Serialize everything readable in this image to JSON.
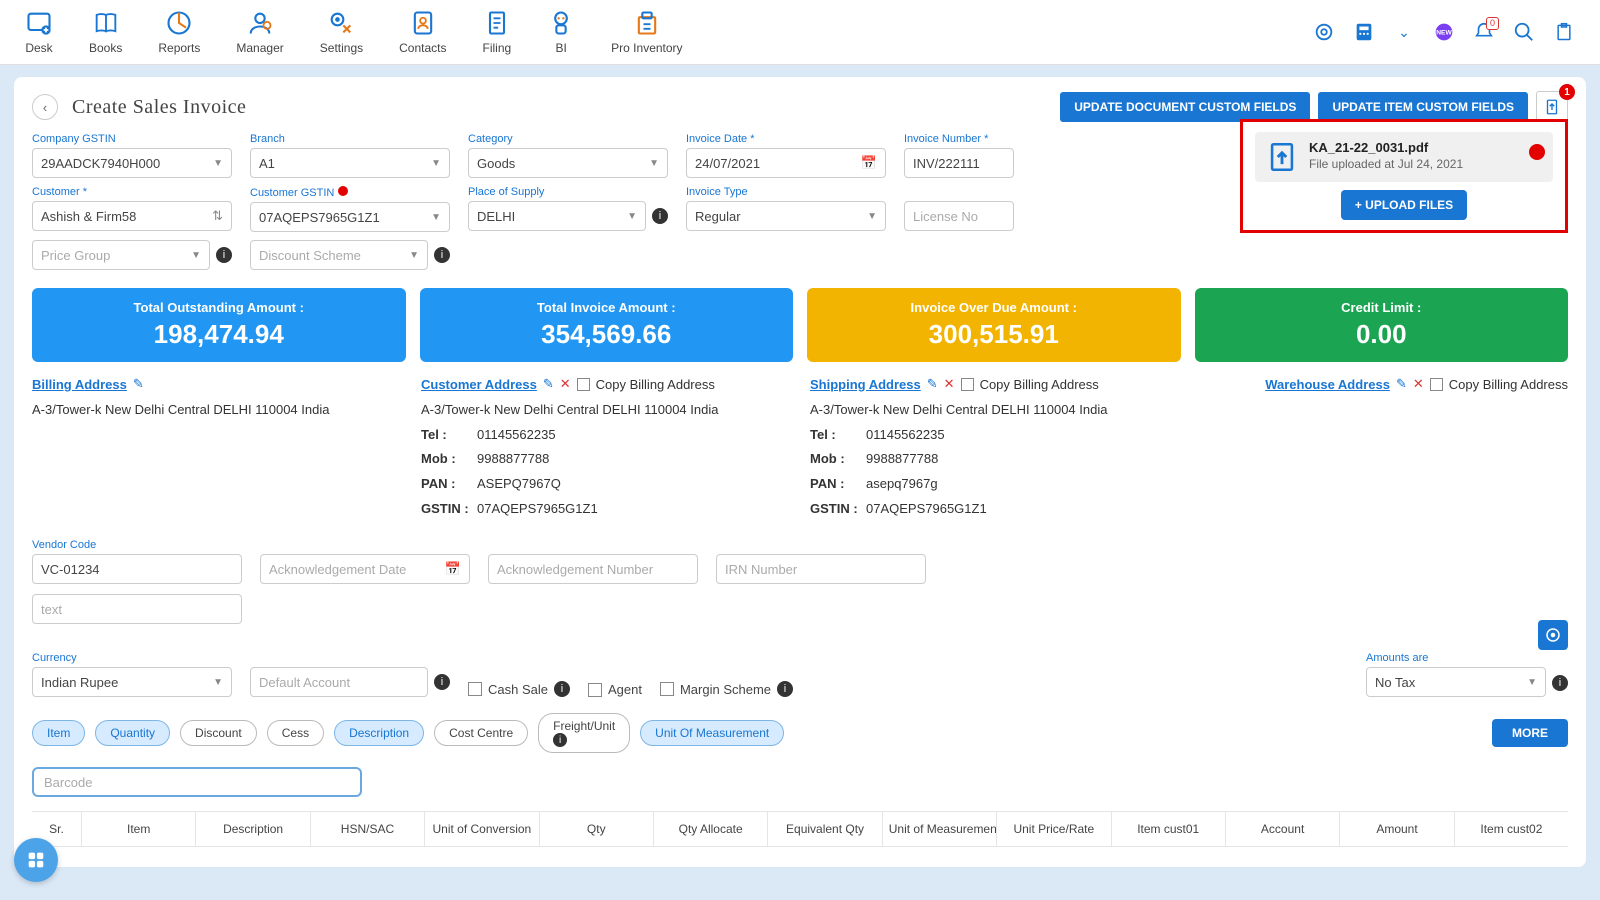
{
  "topnav": {
    "items": [
      "Desk",
      "Books",
      "Reports",
      "Manager",
      "Settings",
      "Contacts",
      "Filing",
      "BI",
      "Pro Inventory"
    ],
    "notif_count": "0"
  },
  "page": {
    "title": "Create Sales Invoice",
    "btn_doc_custom": "UPDATE DOCUMENT CUSTOM FIELDS",
    "btn_item_custom": "UPDATE ITEM CUSTOM FIELDS",
    "attach_count": "1"
  },
  "upload": {
    "filename": "KA_21-22_0031.pdf",
    "status": "File uploaded at Jul 24, 2021",
    "btn": "+ UPLOAD FILES"
  },
  "f": {
    "company_gstin_label": "Company GSTIN",
    "company_gstin": "29AADCK7940H000",
    "branch_label": "Branch",
    "branch": "A1",
    "category_label": "Category",
    "category": "Goods",
    "invoice_date_label": "Invoice Date *",
    "invoice_date": "24/07/2021",
    "invoice_no_label": "Invoice Number *",
    "invoice_no": "INV/222111",
    "customer_label": "Customer *",
    "customer": "Ashish & Firm58",
    "cust_gstin_label": "Customer GSTIN",
    "cust_gstin": "07AQEPS7965G1Z1",
    "pos_label": "Place of Supply",
    "pos": "DELHI",
    "inv_type_label": "Invoice Type",
    "inv_type": "Regular",
    "license_ph": "License No",
    "price_group_ph": "Price Group",
    "discount_scheme_ph": "Discount Scheme"
  },
  "summary": {
    "outstanding_label": "Total Outstanding Amount :",
    "outstanding": "198,474.94",
    "invoice_label": "Total Invoice Amount :",
    "invoice": "354,569.66",
    "overdue_label": "Invoice Over Due Amount :",
    "overdue": "300,515.91",
    "credit_label": "Credit Limit :",
    "credit": "0.00"
  },
  "addr": {
    "billing_title": "Billing Address",
    "billing_text": "A-3/Tower-k New Delhi Central DELHI 110004 India",
    "customer_title": "Customer Address",
    "shipping_title": "Shipping Address",
    "warehouse_title": "Warehouse Address",
    "copy_label": "Copy Billing Address",
    "line_addr": "A-3/Tower-k New Delhi Central DELHI 110004 India",
    "tel_label": "Tel :",
    "tel": "01145562235",
    "mob_label": "Mob :",
    "mob": "9988877788",
    "pan_label": "PAN :",
    "pan_cust": "ASEPQ7967Q",
    "pan_ship": "asepq7967g",
    "gstin_label": "GSTIN :",
    "gstin": "07AQEPS7965G1Z1"
  },
  "vc": {
    "vendor_code_label": "Vendor Code",
    "vendor_code": "VC-01234",
    "ack_date_ph": "Acknowledgement Date",
    "ack_no_ph": "Acknowledgement Number",
    "irn_ph": "IRN Number",
    "text_ph": "text"
  },
  "curr": {
    "currency_label": "Currency",
    "currency": "Indian Rupee",
    "default_account_ph": "Default Account",
    "cash_sale": "Cash Sale",
    "agent": "Agent",
    "margin": "Margin Scheme",
    "amounts_are_label": "Amounts are",
    "amounts_are": "No Tax"
  },
  "chips": [
    "Item",
    "Quantity",
    "Discount",
    "Cess",
    "Description",
    "Cost Centre",
    "Freight/Unit",
    "Unit Of Measurement"
  ],
  "more_label": "MORE",
  "barcode_ph": "Barcode",
  "tbl": [
    "Sr.",
    "Item",
    "Description",
    "HSN/SAC",
    "Unit of Conversion",
    "Qty",
    "Qty Allocate",
    "Equivalent Qty",
    "Unit of Measurement",
    "Unit Price/Rate",
    "Item cust01",
    "Account",
    "Amount",
    "Item cust02"
  ]
}
